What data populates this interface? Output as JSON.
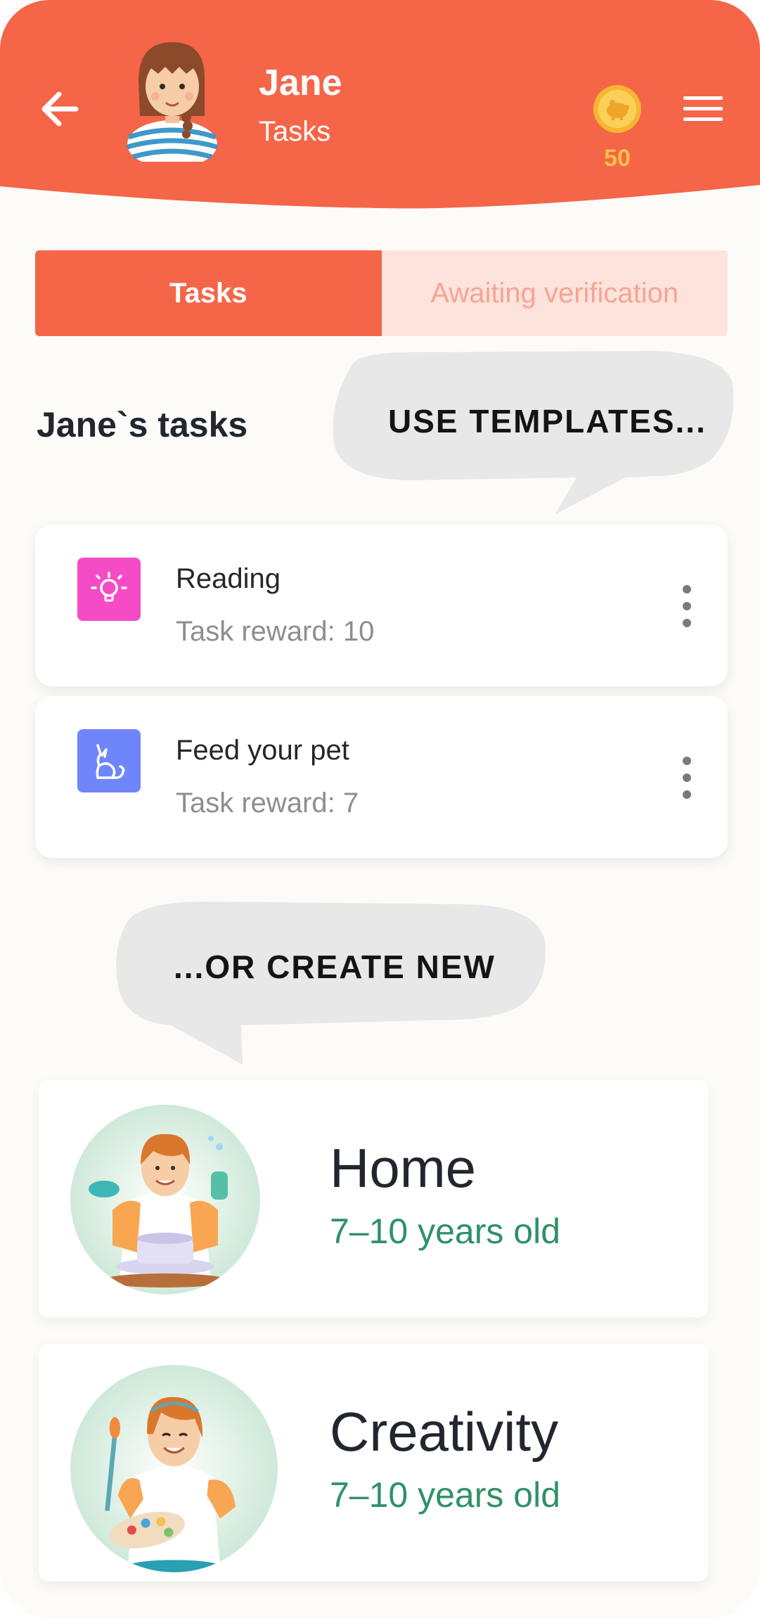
{
  "header": {
    "user_name": "Jane",
    "subtitle": "Tasks",
    "coins": "50",
    "back_icon": "arrow-left-icon",
    "menu_icon": "hamburger-menu-icon",
    "coin_icon": "piggy-coin-icon"
  },
  "tabs": [
    {
      "label": "Tasks",
      "active": true
    },
    {
      "label": "Awaiting verification",
      "active": false
    }
  ],
  "section_title": "Jane`s tasks",
  "callouts": {
    "templates": "USE TEMPLATES...",
    "create": "...OR CREATE NEW"
  },
  "tasks": [
    {
      "name": "Reading",
      "reward": "Task reward: 10",
      "icon": "lightbulb-icon",
      "color": "#f54bc6"
    },
    {
      "name": "Feed your pet",
      "reward": "Task reward: 7",
      "icon": "cat-icon",
      "color": "#6f86fb"
    }
  ],
  "categories": [
    {
      "title": "Home",
      "age": "7–10 years old"
    },
    {
      "title": "Creativity",
      "age": "7–10 years old"
    }
  ],
  "colors": {
    "primary": "#f56548",
    "tab_inactive_bg": "#fde3dc",
    "coin": "#f7c04a",
    "age_text": "#2f9167"
  }
}
